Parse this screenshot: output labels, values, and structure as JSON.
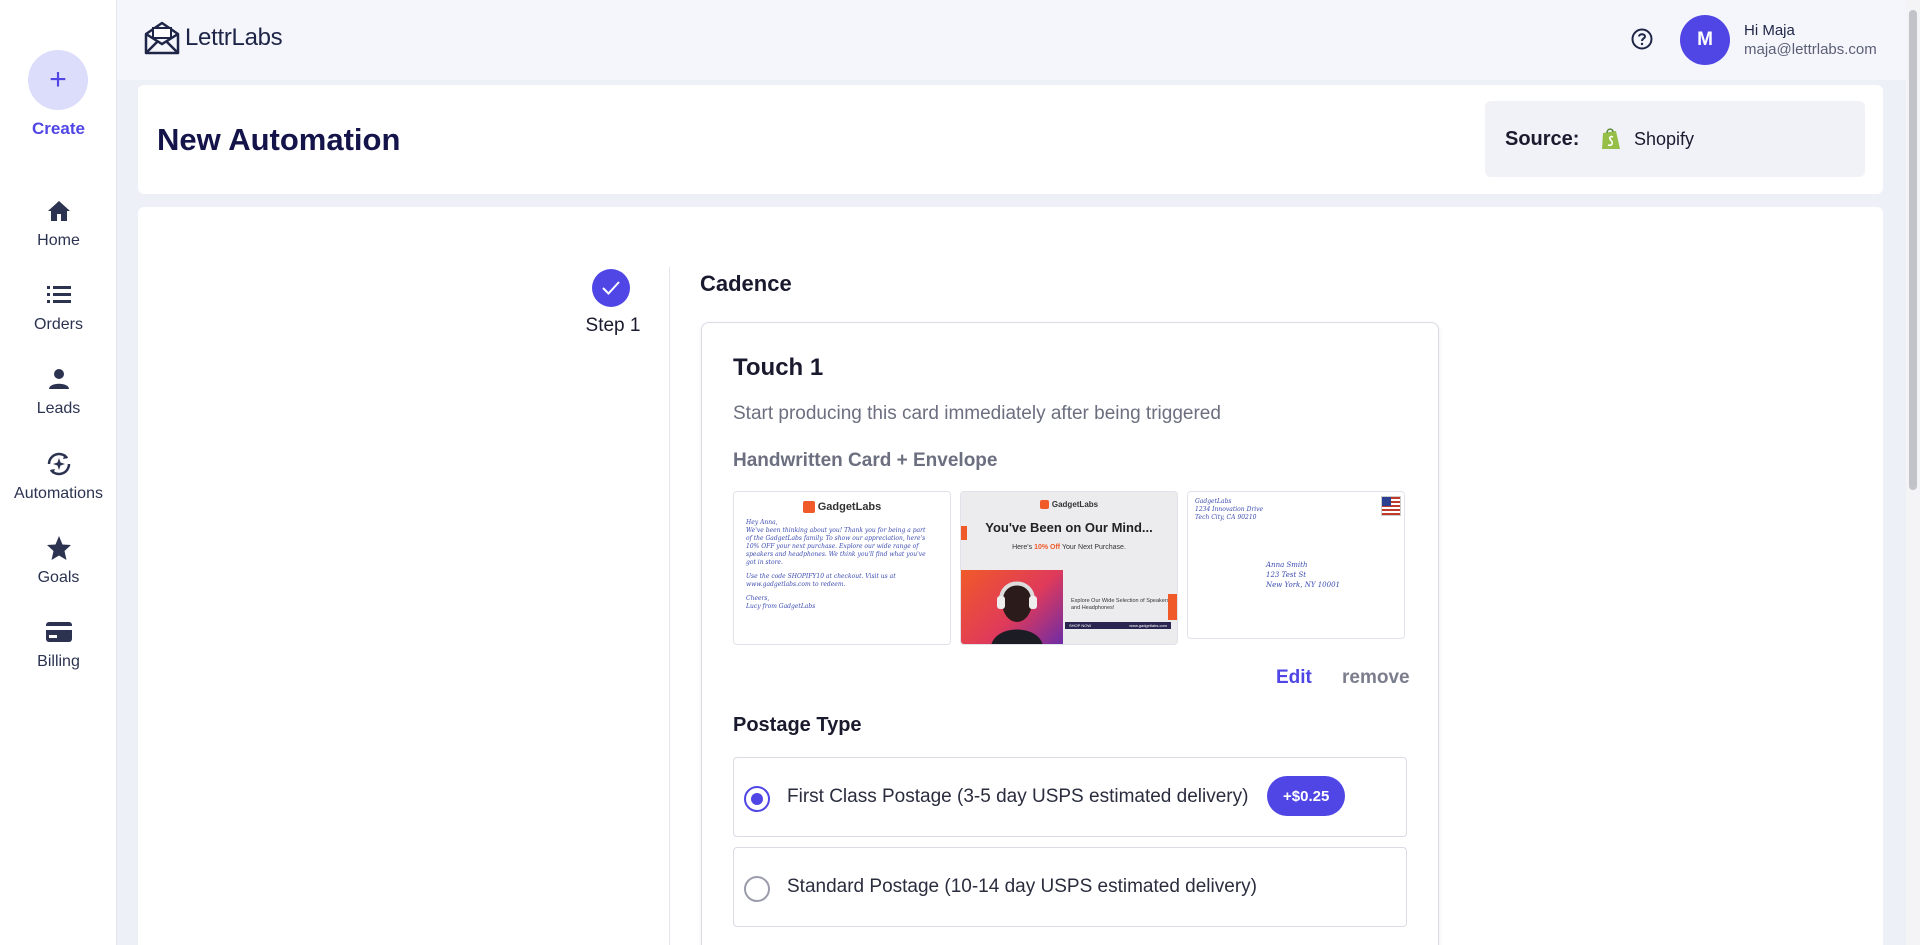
{
  "app": {
    "brand": "LettrLabs"
  },
  "sidebar": {
    "create_label": "Create",
    "items": [
      {
        "label": "Home",
        "icon": "home-icon"
      },
      {
        "label": "Orders",
        "icon": "list-icon"
      },
      {
        "label": "Leads",
        "icon": "person-icon"
      },
      {
        "label": "Automations",
        "icon": "automation-icon"
      },
      {
        "label": "Goals",
        "icon": "star-icon"
      },
      {
        "label": "Billing",
        "icon": "credit-card-icon"
      }
    ]
  },
  "header": {
    "avatar_initial": "M",
    "greeting": "Hi Maja",
    "email": "maja@lettrlabs.com"
  },
  "page": {
    "title": "New Automation",
    "source_label": "Source:",
    "source_value": "Shopify"
  },
  "step": {
    "label": "Step 1",
    "section_title": "Cadence"
  },
  "touch": {
    "title": "Touch 1",
    "description": "Start producing this card immediately after being triggered",
    "product": "Handwritten Card + Envelope",
    "edit_label": "Edit",
    "remove_label": "remove",
    "card_inside": {
      "brand": "GadgetLabs",
      "lines": [
        "Hey Anna,",
        "We've been thinking about you! Thank you for being a part",
        "of the GadgetLabs family. To show our appreciation, here's",
        "10% OFF your next purchase. Explore our wide range of",
        "speakers and headphones. We think you'll find what you've",
        "got in store.",
        "",
        "Use the code SHOPIFY10 at checkout. Visit us at",
        "www.gadgetlabs.com to redeem.",
        "",
        "Cheers,",
        "Lucy from GadgetLabs"
      ]
    },
    "card_front": {
      "brand": "GadgetLabs",
      "headline": "You've Been on Our Mind...",
      "offer_prefix": "Here's ",
      "offer_highlight": "10% Off",
      "offer_suffix": " Your Next Purchase.",
      "explore": "Explore Our Wide Selection of Speakers and Headphones!",
      "cta": "SHOP NOW",
      "url": "www.gadgetlabs.com"
    },
    "envelope": {
      "return_lines": [
        "GadgetLabs",
        "1234 Innovation Drive",
        "Tech City, CA 90210"
      ],
      "recipient_lines": [
        "Anna Smith",
        "123 Test St",
        "New York, NY 10001"
      ]
    },
    "postage_title": "Postage Type",
    "postage_options": [
      {
        "label": "First Class Postage (3-5 day USPS estimated delivery)",
        "badge": "+$0.25",
        "selected": true
      },
      {
        "label": "Standard Postage (10-14 day USPS estimated delivery)",
        "selected": false
      }
    ]
  },
  "colors": {
    "accent": "#4f46e5",
    "shopify_green": "#95bf47",
    "orange": "#f05a28"
  }
}
